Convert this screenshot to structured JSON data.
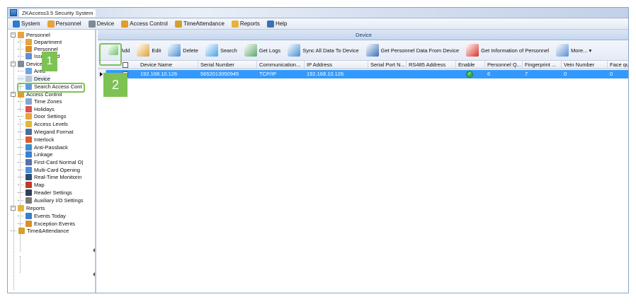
{
  "window": {
    "title": "ZKAccess3.5 Security System"
  },
  "menubar": [
    {
      "label": "System",
      "icon": "system-icon",
      "color": "#2b7bd0"
    },
    {
      "label": "Personnel",
      "icon": "personnel-icon",
      "color": "#e8a33a"
    },
    {
      "label": "Device",
      "icon": "gear-icon",
      "color": "#7f8a96"
    },
    {
      "label": "Access Control",
      "icon": "access-control-icon",
      "color": "#e59b2c"
    },
    {
      "label": "TimeAttendance",
      "icon": "time-attendance-icon",
      "color": "#d4a12e"
    },
    {
      "label": "Reports",
      "icon": "reports-icon",
      "color": "#e6b43a"
    },
    {
      "label": "Help",
      "icon": "help-icon",
      "color": "#3b6fb8"
    }
  ],
  "sidebar": {
    "nodes": [
      {
        "id": "personnel",
        "label": "Personnel",
        "icon": "personnel-icon",
        "color": "#e8a33a",
        "expander": "−"
      },
      {
        "id": "department",
        "label": "Department",
        "icon": "department-icon",
        "color": "#e8a33a"
      },
      {
        "id": "personnel-child",
        "label": "Personnel",
        "icon": "person-icon",
        "color": "#d98f2a"
      },
      {
        "id": "issue-card",
        "label": "Issue Card",
        "icon": "card-icon",
        "color": "#5d8fd6"
      },
      {
        "id": "device-group",
        "label": "Device",
        "icon": "gear-icon",
        "color": "#7f8a96",
        "expander": "−"
      },
      {
        "id": "area",
        "label": "Area",
        "icon": "area-icon",
        "color": "#6ba3e0"
      },
      {
        "id": "device",
        "label": "Device",
        "icon": "device-icon",
        "color": "#b8c4d4"
      },
      {
        "id": "search-access",
        "label": "Search Access Cont",
        "icon": "search-icon",
        "color": "#5a9be0"
      },
      {
        "id": "access-control",
        "label": "Access Control",
        "icon": "access-control-icon",
        "color": "#e59b2c",
        "expander": "−"
      },
      {
        "id": "time-zones",
        "label": "Time Zones",
        "icon": "clock-icon",
        "color": "#7fa9d9"
      },
      {
        "id": "holidays",
        "label": "Holidays",
        "icon": "holiday-icon",
        "color": "#d9534f"
      },
      {
        "id": "door-settings",
        "label": "Door Settings",
        "icon": "door-icon",
        "color": "#e8a33a"
      },
      {
        "id": "access-levels",
        "label": "Access Levels",
        "icon": "key-icon",
        "color": "#e6b43a"
      },
      {
        "id": "wiegand-format",
        "label": "Wiegand Format",
        "icon": "wiegand-icon",
        "color": "#4a6f9e"
      },
      {
        "id": "interlock",
        "label": "Interlock",
        "icon": "interlock-icon",
        "color": "#e05a2a"
      },
      {
        "id": "anti-passback",
        "label": "Anti-Passback",
        "icon": "anti-passback-icon",
        "color": "#3a8fd0"
      },
      {
        "id": "linkage",
        "label": "Linkage",
        "icon": "linkage-icon",
        "color": "#3f7fcf"
      },
      {
        "id": "first-card",
        "label": "First-Card Normal O|",
        "icon": "first-card-icon",
        "color": "#5a6fae"
      },
      {
        "id": "multi-card",
        "label": "Multi-Card Opening",
        "icon": "multi-card-icon",
        "color": "#4d8fd6"
      },
      {
        "id": "real-time",
        "label": "Real-Time Monitorin",
        "icon": "monitor-icon",
        "color": "#2d4d6e"
      },
      {
        "id": "map",
        "label": "Map",
        "icon": "map-icon",
        "color": "#c0392b"
      },
      {
        "id": "reader-settings",
        "label": "Reader Settings",
        "icon": "reader-icon",
        "color": "#2f3f55"
      },
      {
        "id": "auxiliary-io",
        "label": "Auxiliary I/O Settings",
        "icon": "auxiliary-icon",
        "color": "#7a7a7a"
      },
      {
        "id": "reports",
        "label": "Reports",
        "icon": "reports-icon",
        "color": "#e6b43a",
        "expander": "−"
      },
      {
        "id": "events-today",
        "label": "Events Today",
        "icon": "events-icon",
        "color": "#3a7fc8"
      },
      {
        "id": "exception-events",
        "label": "Exception Events",
        "icon": "exception-icon",
        "color": "#d98f2a"
      },
      {
        "id": "time-attendance",
        "label": "Time&Attendance",
        "icon": "time-attendance-icon",
        "color": "#d4a12e"
      }
    ]
  },
  "content": {
    "panel_title": "Device",
    "toolbar": [
      {
        "label": "Add",
        "icon": "add-icon",
        "color": "#6ec36e"
      },
      {
        "label": "Edit",
        "icon": "edit-icon",
        "color": "#e0a23a"
      },
      {
        "label": "Delete",
        "icon": "delete-icon",
        "color": "#4a8fd6"
      },
      {
        "label": "Search",
        "icon": "search-icon",
        "color": "#4aa3e6"
      },
      {
        "label": "Get Logs",
        "icon": "get-logs-icon",
        "color": "#5ca86a"
      },
      {
        "label": "Sync All Data To Device",
        "icon": "sync-icon",
        "color": "#4a8fd6"
      },
      {
        "label": "Get Personnel Data From Device",
        "icon": "get-personnel-icon",
        "color": "#3a6fb8"
      },
      {
        "label": "Get Information of Personnel",
        "icon": "info-personnel-icon",
        "color": "#d9342b"
      },
      {
        "label": "More... ▾",
        "icon": "more-icon",
        "color": "#5a8fd6"
      }
    ],
    "columns": [
      "Device Name",
      "Serial Number",
      "Communication...",
      "IP Address",
      "Serial Port N...",
      "RS485 Address",
      "Enable",
      "Personnel Q...",
      "Fingerprint ...",
      "Vein Number",
      "Face qu"
    ],
    "rows": [
      {
        "device_name": "192.168.10.126",
        "serial_number": "5652013050945",
        "communication": "TCP/IP",
        "ip_address": "192.168.10.126",
        "serial_port": "",
        "rs485_address": "",
        "enable": "✓",
        "personnel_qty": "6",
        "fingerprint": "7",
        "vein_number": "0",
        "face_qty": "0"
      }
    ]
  },
  "callouts": {
    "step1": "1",
    "step2": "2",
    "color": "#7dc253"
  }
}
